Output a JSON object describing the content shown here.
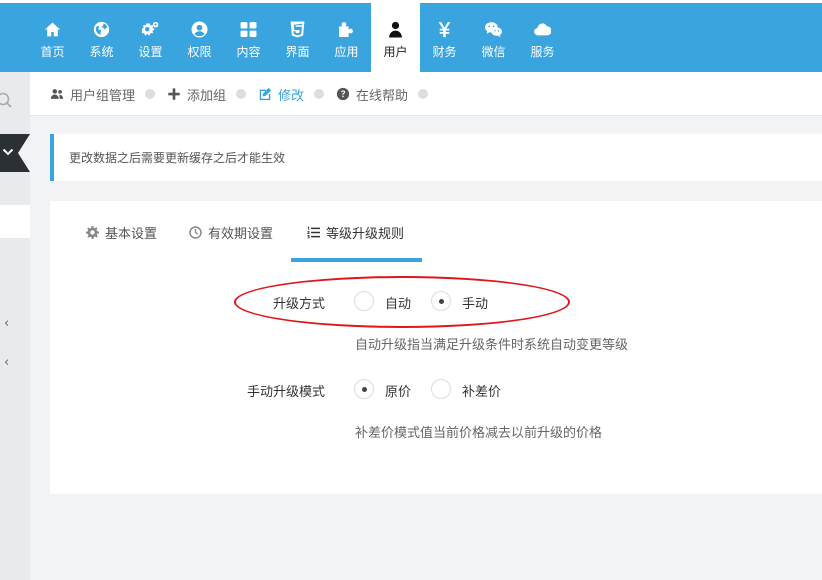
{
  "topnav": {
    "items": [
      {
        "label": "首页",
        "icon": "home-icon"
      },
      {
        "label": "系统",
        "icon": "globe-icon"
      },
      {
        "label": "设置",
        "icon": "cogs-icon"
      },
      {
        "label": "权限",
        "icon": "user-circle-icon"
      },
      {
        "label": "内容",
        "icon": "th-large-icon"
      },
      {
        "label": "界面",
        "icon": "html5-icon"
      },
      {
        "label": "应用",
        "icon": "puzzle-icon"
      },
      {
        "label": "用户",
        "icon": "user-icon",
        "active": true
      },
      {
        "label": "财务",
        "icon": "yen-icon"
      },
      {
        "label": "微信",
        "icon": "wechat-icon"
      },
      {
        "label": "服务",
        "icon": "cloud-icon"
      }
    ]
  },
  "breadcrumb": {
    "items": [
      {
        "label": "用户组管理",
        "icon": "users-icon"
      },
      {
        "label": "添加组",
        "icon": "plus-icon"
      },
      {
        "label": "修改",
        "icon": "edit-icon",
        "active": true
      },
      {
        "label": "在线帮助",
        "icon": "question-circle-icon"
      }
    ]
  },
  "notice": {
    "text": "更改数据之后需要更新缓存之后才能生效"
  },
  "tabs": [
    {
      "label": "基本设置",
      "icon": "cog-icon"
    },
    {
      "label": "有效期设置",
      "icon": "clock-icon"
    },
    {
      "label": "等级升级规则",
      "icon": "list-ol-icon",
      "active": true
    }
  ],
  "form": {
    "upgrade_method": {
      "label": "升级方式",
      "options": [
        "自动",
        "手动"
      ],
      "selected": "手动",
      "help": "自动升级指当满足升级条件时系统自动变更等级"
    },
    "manual_mode": {
      "label": "手动升级模式",
      "options": [
        "原价",
        "补差价"
      ],
      "selected": "原价",
      "help": "补差价模式值当前价格减去以前升级的价格"
    }
  },
  "colors": {
    "accent": "#3aa4df",
    "annotation": "#e1161b",
    "sidebar_dark": "#2b3034"
  }
}
